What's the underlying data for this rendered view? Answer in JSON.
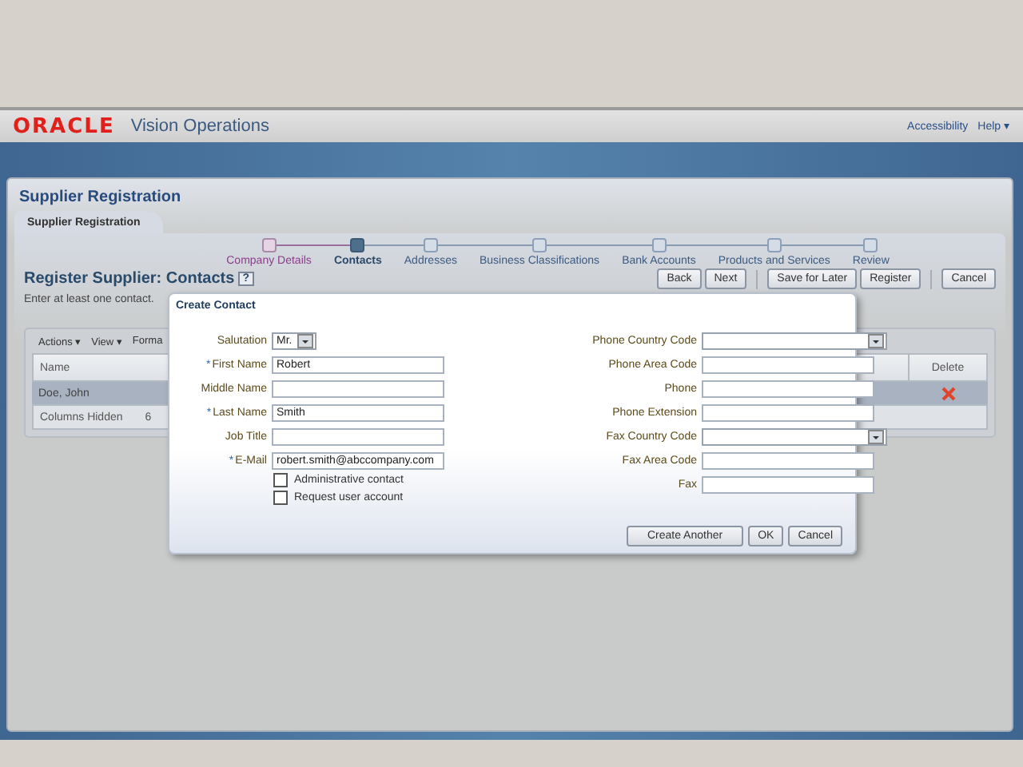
{
  "header": {
    "logo": "ORACLE",
    "app_title": "Vision Operations",
    "links": [
      {
        "label": "Accessibility"
      },
      {
        "label": "Help",
        "caret": "▾"
      }
    ]
  },
  "page": {
    "title": "Supplier Registration",
    "tab": {
      "label": "Supplier Registration",
      "selected": true
    }
  },
  "train": [
    {
      "label": "Company Details",
      "visited": true,
      "selected": false
    },
    {
      "label": "Contacts",
      "visited": true,
      "selected": true
    },
    {
      "label": "Addresses",
      "visited": false,
      "selected": false
    },
    {
      "label": "Business Classifications",
      "visited": false,
      "selected": false
    },
    {
      "label": "Bank Accounts",
      "visited": false,
      "selected": false
    },
    {
      "label": "Products and Services",
      "visited": false,
      "selected": false
    },
    {
      "label": "Review",
      "visited": false,
      "selected": false
    }
  ],
  "section": {
    "title": "Register Supplier: Contacts",
    "help": "?",
    "instruction": "Enter at least one contact."
  },
  "action_groups": [
    [
      "Back",
      "Next"
    ],
    [
      "Save for Later",
      "Register"
    ],
    [
      "Cancel"
    ]
  ],
  "table": {
    "toolbar": [
      {
        "label": "Actions",
        "caret": "▾"
      },
      {
        "label": "View",
        "caret": "▾"
      },
      {
        "label": "Forma"
      }
    ],
    "columns": [
      "Name",
      "Delete"
    ],
    "rows": [
      {
        "name": "Doe, John",
        "selected": true
      }
    ],
    "footer": {
      "label": "Columns Hidden",
      "count": "6"
    }
  },
  "dialog": {
    "title": "Create Contact",
    "left_fields": [
      {
        "label": "Salutation",
        "kind": "select",
        "value": "Mr."
      },
      {
        "label": "First Name",
        "kind": "text",
        "value": "Robert",
        "required_mark": "*"
      },
      {
        "label": "Middle Name",
        "kind": "text"
      },
      {
        "label": "Last Name",
        "kind": "text",
        "value": "Smith",
        "required_mark": "*"
      },
      {
        "label": "Job Title",
        "kind": "text"
      },
      {
        "label": "E-Mail",
        "kind": "text",
        "value": "robert.smith@abccompany.com",
        "required_mark": "*"
      }
    ],
    "checkboxes": [
      {
        "label": "Administrative contact",
        "checked": false
      },
      {
        "label": "Request user account",
        "checked": false
      }
    ],
    "right_fields": [
      {
        "label": "Phone Country Code",
        "kind": "select"
      },
      {
        "label": "Phone Area Code",
        "kind": "text"
      },
      {
        "label": "Phone",
        "kind": "text"
      },
      {
        "label": "Phone Extension",
        "kind": "text"
      },
      {
        "label": "Fax Country Code",
        "kind": "select"
      },
      {
        "label": "Fax Area Code",
        "kind": "text"
      },
      {
        "label": "Fax",
        "kind": "text"
      }
    ],
    "buttons": [
      "Create Another",
      "OK",
      "Cancel"
    ]
  }
}
